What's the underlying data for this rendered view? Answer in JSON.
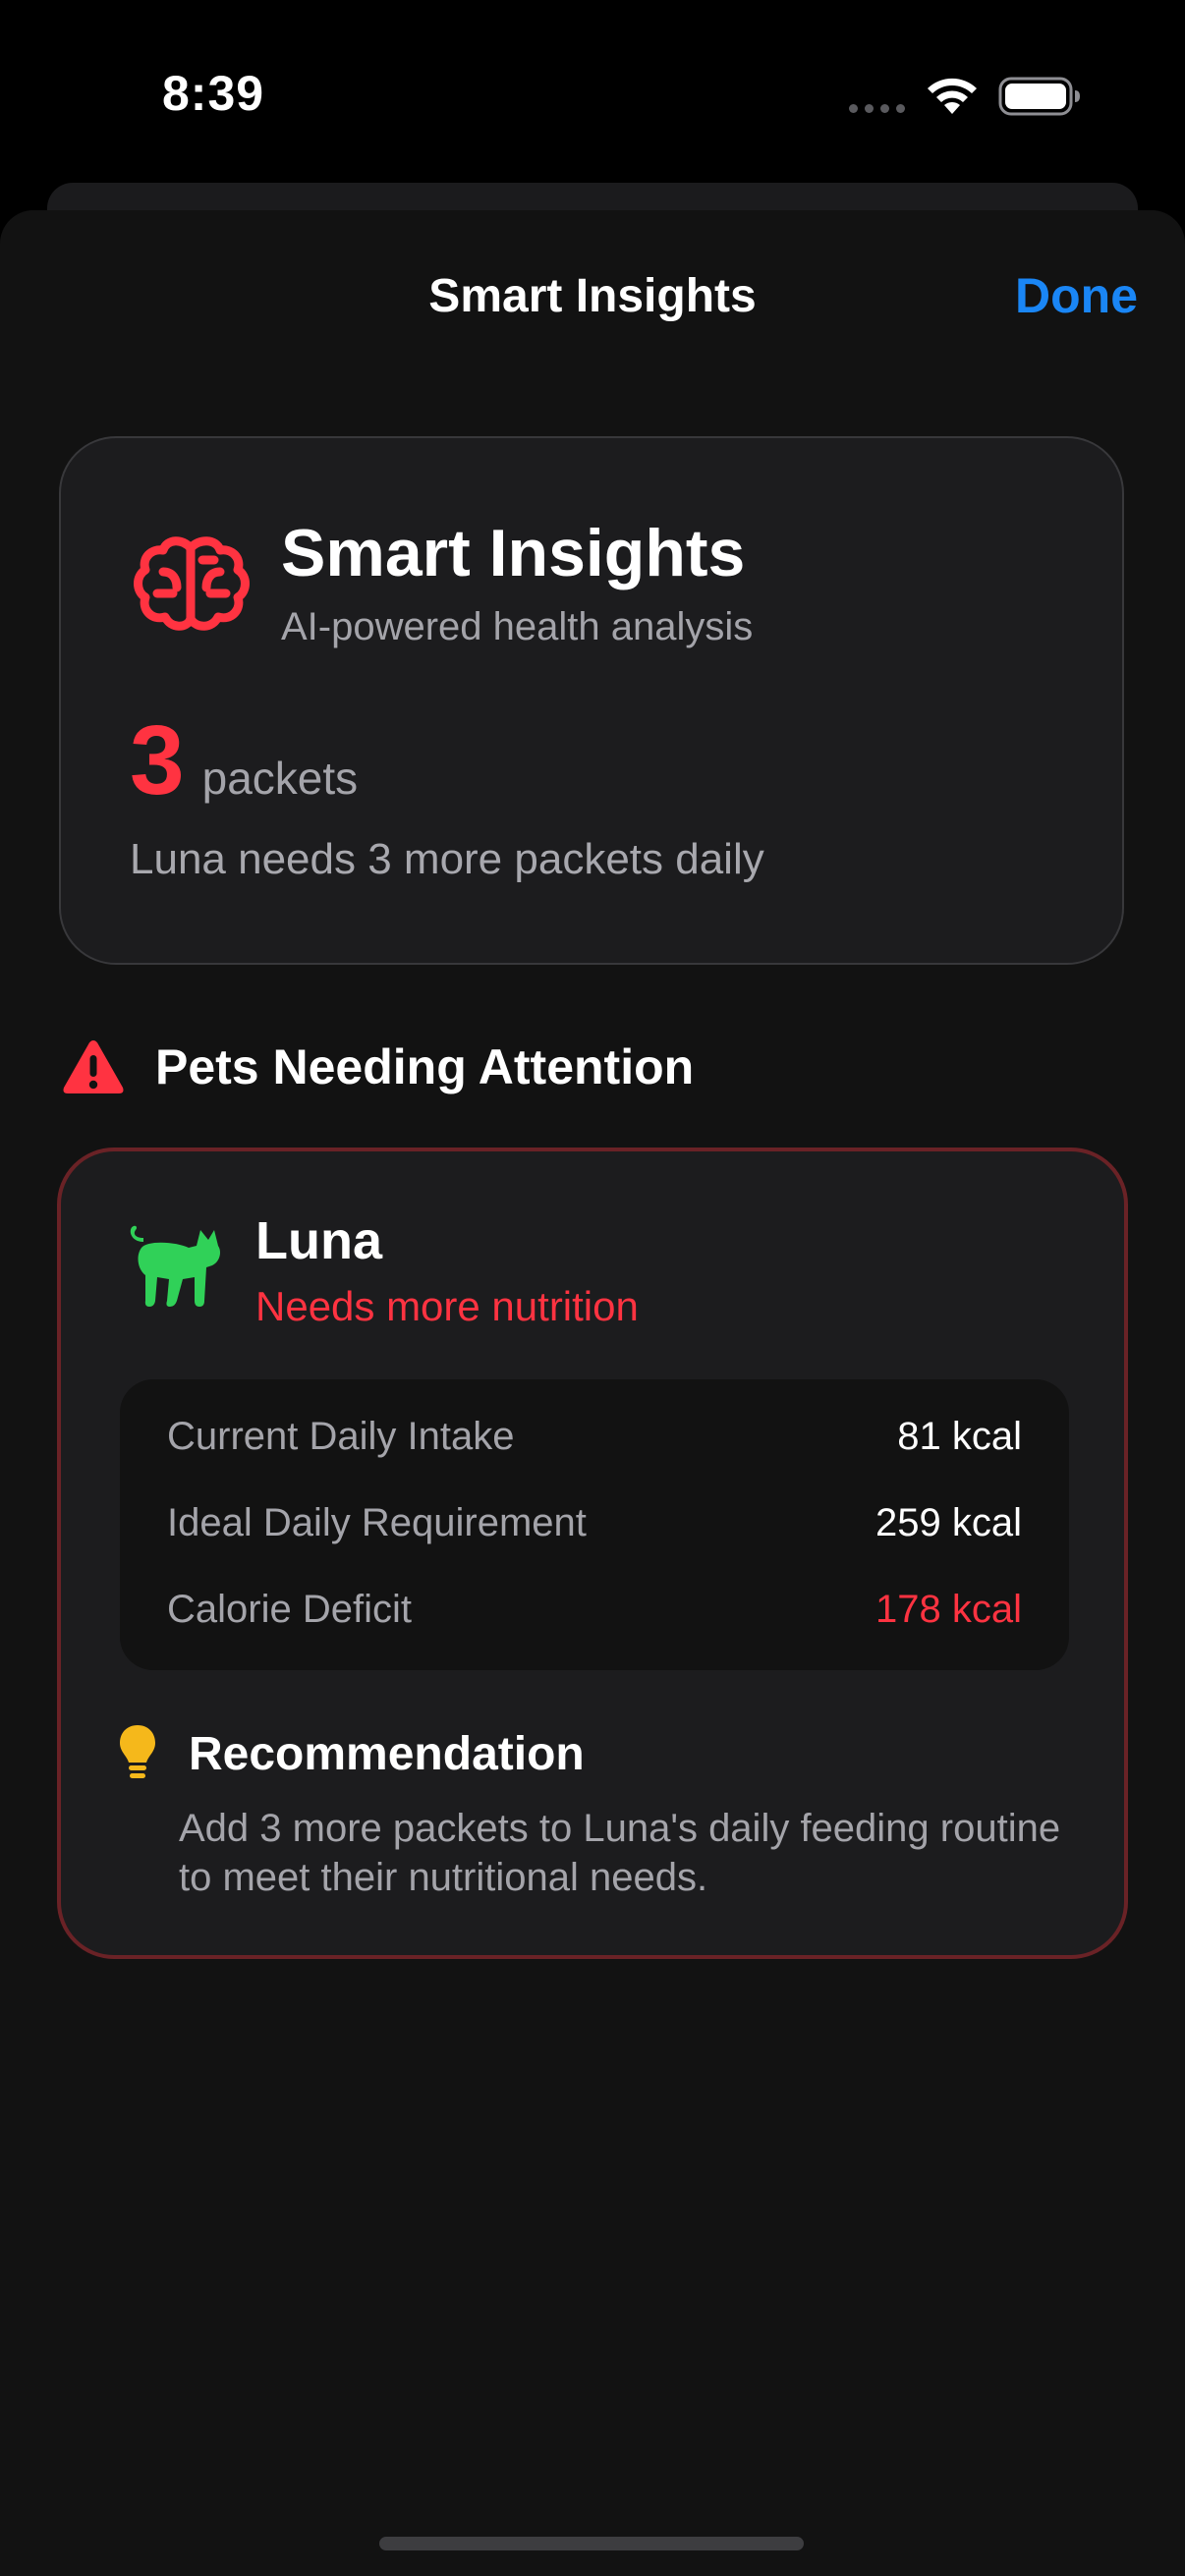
{
  "status_bar": {
    "time": "8:39"
  },
  "nav": {
    "title": "Smart Insights",
    "done_label": "Done"
  },
  "summary": {
    "title": "Smart Insights",
    "subtitle": "AI-powered health analysis",
    "count": "3",
    "count_unit": "packets",
    "message": "Luna needs 3 more packets daily",
    "icon": "brain-icon"
  },
  "attention": {
    "heading": "Pets Needing Attention",
    "icon": "warning-triangle-icon"
  },
  "pet": {
    "name": "Luna",
    "status": "Needs more nutrition",
    "icon": "cat-icon",
    "stats": [
      {
        "label": "Current Daily Intake",
        "value": "81 kcal"
      },
      {
        "label": "Ideal Daily Requirement",
        "value": "259 kcal"
      },
      {
        "label": "Calorie Deficit",
        "value": "178 kcal"
      }
    ],
    "recommendation": {
      "title": "Recommendation",
      "body": "Add 3 more packets to Luna's daily feeding routine to meet their nutritional needs.",
      "icon": "lightbulb-icon"
    }
  },
  "colors": {
    "accent_blue": "#1a86f5",
    "alert_red": "#ff3341",
    "pet_green": "#30d158",
    "bulb_yellow": "#f5b81b"
  }
}
